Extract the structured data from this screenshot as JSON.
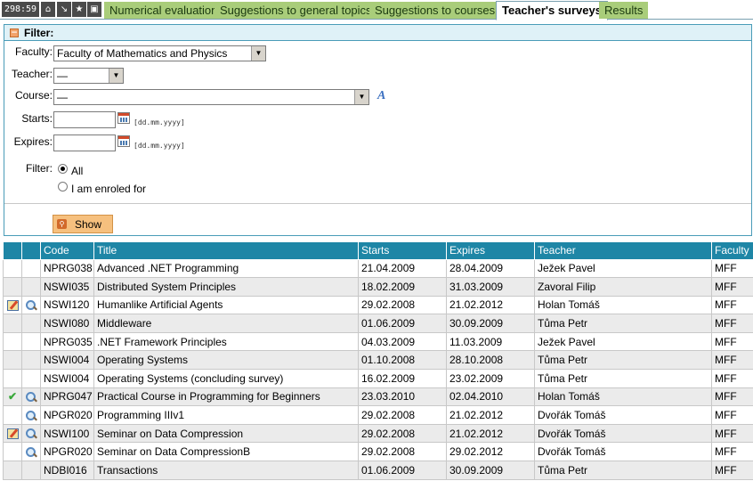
{
  "topbar": {
    "timer": "298:59",
    "icons": [
      "home-icon",
      "logout-icon",
      "favorite-icon",
      "print-icon"
    ],
    "tabs": [
      {
        "label": "Numerical evaluation",
        "active": false
      },
      {
        "label": "Suggestions to general topics",
        "active": false
      },
      {
        "label": "Suggestions to courses",
        "active": false
      },
      {
        "label": "Teacher's surveys",
        "active": true
      },
      {
        "label": "Results",
        "active": false
      }
    ]
  },
  "filter": {
    "title": "Filter:",
    "faculty_label": "Faculty:",
    "faculty_value": "Faculty of Mathematics and Physics",
    "teacher_label": "Teacher:",
    "teacher_value": "—",
    "course_label": "Course:",
    "course_value": "—",
    "starts_label": "Starts:",
    "starts_value": "",
    "starts_format": "[dd.mm.yyyy]",
    "expires_label": "Expires:",
    "expires_value": "",
    "expires_format": "[dd.mm.yyyy]",
    "filter_label": "Filter:",
    "options": [
      {
        "label": "All",
        "checked": true
      },
      {
        "label": "I am enroled for",
        "checked": false
      }
    ],
    "show_button": "Show"
  },
  "table": {
    "columns": [
      "",
      "",
      "Code",
      "Title",
      "Starts",
      "Expires",
      "Teacher",
      "Faculty"
    ],
    "rows": [
      {
        "icon1": "",
        "icon2": "",
        "code": "NPRG038",
        "title": "Advanced .NET Programming",
        "starts": "21.04.2009",
        "expires": "28.04.2009",
        "teacher": "Ježek Pavel",
        "faculty": "MFF"
      },
      {
        "icon1": "",
        "icon2": "",
        "code": "NSWI035",
        "title": "Distributed System Principles",
        "starts": "18.02.2009",
        "expires": "31.03.2009",
        "teacher": "Zavoral Filip",
        "faculty": "MFF"
      },
      {
        "icon1": "edit-icon",
        "icon2": "magnifier-icon",
        "code": "NSWI120",
        "title": "Humanlike Artificial Agents",
        "starts": "29.02.2008",
        "expires": "21.02.2012",
        "teacher": "Holan Tomáš",
        "faculty": "MFF"
      },
      {
        "icon1": "",
        "icon2": "",
        "code": "NSWI080",
        "title": "Middleware",
        "starts": "01.06.2009",
        "expires": "30.09.2009",
        "teacher": "Tůma Petr",
        "faculty": "MFF"
      },
      {
        "icon1": "",
        "icon2": "",
        "code": "NPRG035",
        "title": ".NET Framework Principles",
        "starts": "04.03.2009",
        "expires": "11.03.2009",
        "teacher": "Ježek Pavel",
        "faculty": "MFF"
      },
      {
        "icon1": "",
        "icon2": "",
        "code": "NSWI004",
        "title": "Operating Systems",
        "starts": "01.10.2008",
        "expires": "28.10.2008",
        "teacher": "Tůma Petr",
        "faculty": "MFF"
      },
      {
        "icon1": "",
        "icon2": "",
        "code": "NSWI004",
        "title": "Operating Systems (concluding survey)",
        "starts": "16.02.2009",
        "expires": "23.02.2009",
        "teacher": "Tůma Petr",
        "faculty": "MFF"
      },
      {
        "icon1": "check-icon",
        "icon2": "magnifier-icon",
        "code": "NPRG047",
        "title": "Practical Course in Programming for Beginners",
        "starts": "23.03.2010",
        "expires": "02.04.2010",
        "teacher": "Holan Tomáš",
        "faculty": "MFF"
      },
      {
        "icon1": "",
        "icon2": "magnifier-icon",
        "code": "NPGR020",
        "title": "Programming IIIv1",
        "starts": "29.02.2008",
        "expires": "21.02.2012",
        "teacher": "Dvořák Tomáš",
        "faculty": "MFF"
      },
      {
        "icon1": "edit-icon",
        "icon2": "magnifier-icon",
        "code": "NSWI100",
        "title": "Seminar on Data Compression",
        "starts": "29.02.2008",
        "expires": "21.02.2012",
        "teacher": "Dvořák Tomáš",
        "faculty": "MFF"
      },
      {
        "icon1": "",
        "icon2": "magnifier-icon",
        "code": "NPGR020",
        "title": "Seminar on Data CompressionB",
        "starts": "29.02.2008",
        "expires": "29.02.2012",
        "teacher": "Dvořák Tomáš",
        "faculty": "MFF"
      },
      {
        "icon1": "",
        "icon2": "",
        "code": "NDBI016",
        "title": "Transactions",
        "starts": "01.06.2009",
        "expires": "30.09.2009",
        "teacher": "Tůma Petr",
        "faculty": "MFF"
      }
    ]
  }
}
